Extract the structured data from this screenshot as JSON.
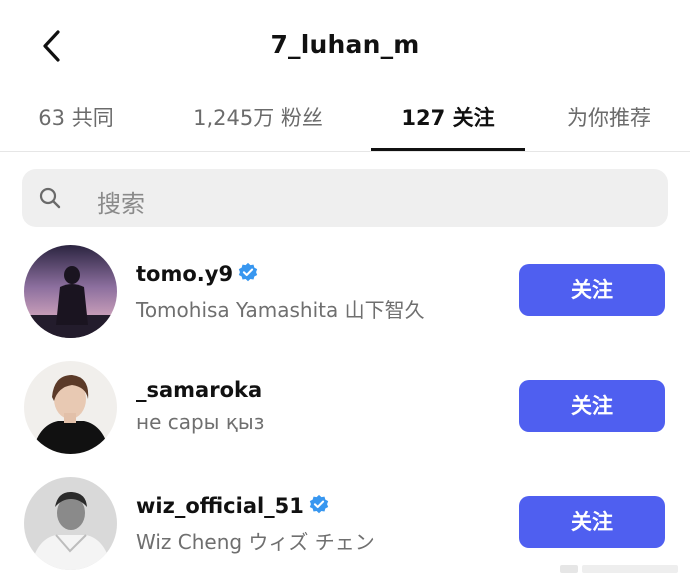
{
  "header": {
    "title": "7_luhan_m",
    "back_icon": "chevron-left-icon"
  },
  "tabs": [
    {
      "label": "63 共同",
      "active": false
    },
    {
      "label": "1,245万 粉丝",
      "active": false
    },
    {
      "label": "127 关注",
      "active": true
    },
    {
      "label": "为你推荐",
      "active": false
    }
  ],
  "search": {
    "placeholder": "搜索",
    "icon": "search-icon"
  },
  "users": [
    {
      "username": "tomo.y9",
      "verified": true,
      "full_name": "Tomohisa Yamashita 山下智久",
      "button_label": "关注"
    },
    {
      "username": "_samaroka",
      "verified": false,
      "full_name": "не сары қыз",
      "button_label": "关注"
    },
    {
      "username": "wiz_official_51",
      "verified": true,
      "full_name": "Wiz Cheng ウィズ チェン",
      "button_label": "关注"
    }
  ],
  "colors": {
    "follow_button": "#4f5ff0",
    "verified_badge": "#3897f0"
  }
}
